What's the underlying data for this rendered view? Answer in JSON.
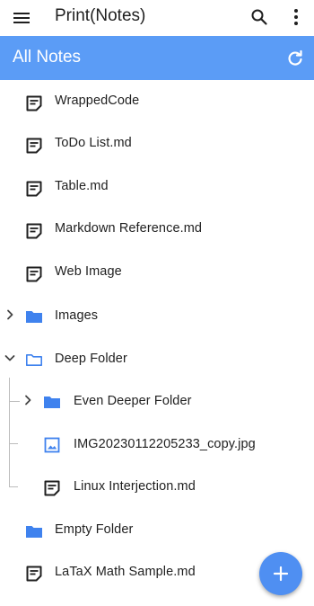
{
  "appbar": {
    "title": "Print(Notes)",
    "menu_icon": "menu-icon",
    "search_icon": "search-icon",
    "more_icon": "more-vert-icon"
  },
  "banner": {
    "label": "All Notes",
    "refresh_icon": "refresh-icon",
    "color": "#5b9cf6"
  },
  "tree": [
    {
      "name": "WrappedCode",
      "type": "note"
    },
    {
      "name": "ToDo List.md",
      "type": "note"
    },
    {
      "name": "Table.md",
      "type": "note"
    },
    {
      "name": "Markdown Reference.md",
      "type": "note"
    },
    {
      "name": "Web Image",
      "type": "note"
    },
    {
      "name": "Images",
      "type": "folder",
      "expanded": false
    },
    {
      "name": "Deep Folder",
      "type": "folder",
      "expanded": true
    },
    {
      "name": "Even Deeper Folder",
      "type": "folder",
      "expanded": false,
      "depth": 1
    },
    {
      "name": "IMG20230112205233_copy.jpg",
      "type": "image",
      "depth": 1
    },
    {
      "name": "Linux Interjection.md",
      "type": "note",
      "depth": 1
    },
    {
      "name": "Empty Folder",
      "type": "folder"
    },
    {
      "name": "LaTaX Math Sample.md",
      "type": "note"
    }
  ],
  "fab": {
    "icon": "add-icon",
    "color": "#4f8ff2"
  }
}
